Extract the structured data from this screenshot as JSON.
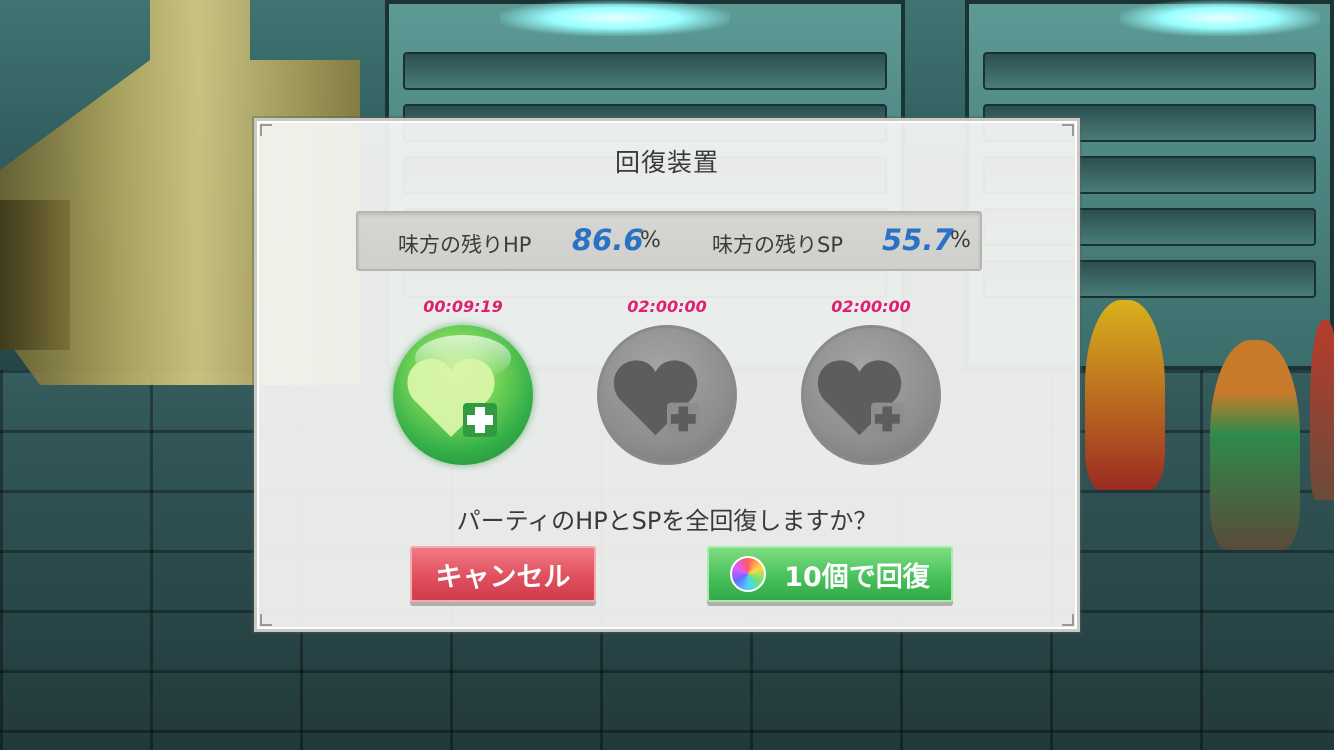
{
  "dialog": {
    "title": "回復装置",
    "stats": {
      "hp_label": "味方の残りHP",
      "hp_value": "86.6",
      "hp_unit": "%",
      "sp_label": "味方の残りSP",
      "sp_value": "55.7",
      "sp_unit": "%"
    },
    "devices": [
      {
        "timer": "00:09:19",
        "state": "ready",
        "icon": "heart-plus-icon"
      },
      {
        "timer": "02:00:00",
        "state": "charging",
        "icon": "heart-plus-icon"
      },
      {
        "timer": "02:00:00",
        "state": "charging",
        "icon": "heart-plus-icon"
      }
    ],
    "question": "パーティのHPとSPを全回復しますか？",
    "cancel_label": "キャンセル",
    "heal_label": "10個で回復",
    "heal_icon": "gem-icon"
  },
  "colors": {
    "timer": "#e0206e",
    "stat_value": "#2a72c6",
    "cancel": "#e0505e",
    "heal": "#48c25c"
  }
}
